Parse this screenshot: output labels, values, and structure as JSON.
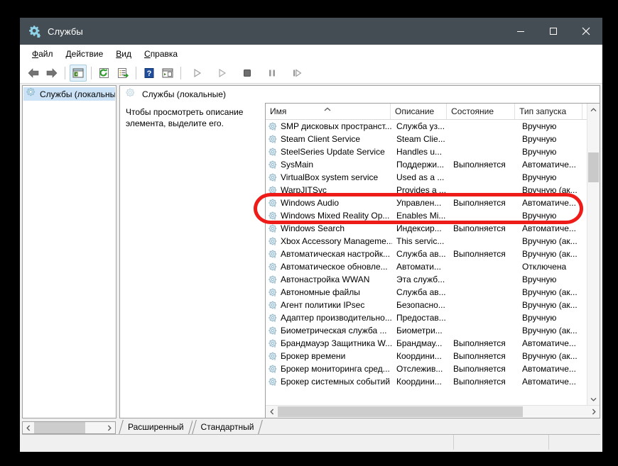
{
  "window": {
    "title": "Службы",
    "title_icon": "services-gear-icon",
    "controls": {
      "minimize": "—",
      "maximize": "□",
      "close": "✕"
    }
  },
  "menubar": {
    "items": [
      {
        "label": "Файл",
        "accel": "Ф"
      },
      {
        "label": "Действие",
        "accel": "Д"
      },
      {
        "label": "Вид",
        "accel": "В"
      },
      {
        "label": "Справка",
        "accel": "С"
      }
    ]
  },
  "toolbar": {
    "buttons": [
      {
        "name": "back-arrow-icon",
        "enabled": true
      },
      {
        "name": "forward-arrow-icon",
        "enabled": true
      },
      {
        "name": "show-hide-console-tree-icon",
        "enabled": true,
        "active": true
      },
      {
        "name": "refresh-icon",
        "enabled": true
      },
      {
        "name": "export-list-icon",
        "enabled": true
      },
      {
        "name": "help-icon",
        "enabled": true
      },
      {
        "name": "show-hide-action-pane-icon",
        "enabled": true
      },
      {
        "name": "start-service-icon",
        "enabled": false
      },
      {
        "name": "restart-service-icon",
        "enabled": false
      },
      {
        "name": "stop-service-icon",
        "enabled": false
      },
      {
        "name": "pause-service-icon",
        "enabled": false
      },
      {
        "name": "resume-service-icon",
        "enabled": false
      }
    ]
  },
  "tree": {
    "items": [
      {
        "label": "Службы (локальны",
        "icon": "services-gear-icon",
        "selected": true
      }
    ]
  },
  "right_pane": {
    "header": "Службы (локальные)",
    "header_icon": "services-gear-icon",
    "description": "Чтобы просмотреть описание элемента, выделите его."
  },
  "list": {
    "columns": [
      {
        "key": "name",
        "label": "Имя",
        "sorted": "asc"
      },
      {
        "key": "description",
        "label": "Описание"
      },
      {
        "key": "state",
        "label": "Состояние"
      },
      {
        "key": "startup",
        "label": "Тип запуска"
      }
    ],
    "rows": [
      {
        "name": "SMP дисковых пространст...",
        "description": "Служба уз...",
        "state": "",
        "startup": "Вручную"
      },
      {
        "name": "Steam Client Service",
        "description": "Steam Clie...",
        "state": "",
        "startup": "Вручную"
      },
      {
        "name": "SteelSeries Update Service",
        "description": "Handles u...",
        "state": "",
        "startup": "Вручную"
      },
      {
        "name": "SysMain",
        "description": "Поддержи...",
        "state": "Выполняется",
        "startup": "Автоматиче..."
      },
      {
        "name": "VirtualBox system service",
        "description": "Used as a ...",
        "state": "",
        "startup": "Вручную"
      },
      {
        "name": "WarpJITSvc",
        "description": "Provides a ...",
        "state": "",
        "startup": "Вручную (ак..."
      },
      {
        "name": "Windows Audio",
        "description": "Управлен...",
        "state": "Выполняется",
        "startup": "Автоматиче...",
        "highlighted": true
      },
      {
        "name": "Windows Mixed Reality Op...",
        "description": "Enables Mi...",
        "state": "",
        "startup": "Вручную"
      },
      {
        "name": "Windows Search",
        "description": "Индексир...",
        "state": "Выполняется",
        "startup": "Автоматиче..."
      },
      {
        "name": "Xbox Accessory Manageme...",
        "description": "This servic...",
        "state": "",
        "startup": "Вручную (ак..."
      },
      {
        "name": "Автоматическая настройк...",
        "description": "Служба ав...",
        "state": "Выполняется",
        "startup": "Вручную (ак..."
      },
      {
        "name": "Автоматическое обновле...",
        "description": "Автомати...",
        "state": "",
        "startup": "Отключена"
      },
      {
        "name": "Автонастройка WWAN",
        "description": "Эта служб...",
        "state": "",
        "startup": "Вручную"
      },
      {
        "name": "Автономные файлы",
        "description": "Служба ав...",
        "state": "",
        "startup": "Вручную (ак..."
      },
      {
        "name": "Агент политики IPsec",
        "description": "Безопасно...",
        "state": "",
        "startup": "Вручную (ак..."
      },
      {
        "name": "Адаптер производительно...",
        "description": "Предостав...",
        "state": "",
        "startup": "Вручную"
      },
      {
        "name": "Биометрическая служба ...",
        "description": "Биометри...",
        "state": "",
        "startup": "Вручную (ак..."
      },
      {
        "name": "Брандмауэр Защитника W...",
        "description": "Брандмау...",
        "state": "Выполняется",
        "startup": "Автоматиче..."
      },
      {
        "name": "Брокер времени",
        "description": "Координи...",
        "state": "Выполняется",
        "startup": "Вручную (ак..."
      },
      {
        "name": "Брокер мониторинга сред...",
        "description": "Отслежив...",
        "state": "Выполняется",
        "startup": "Автоматиче..."
      },
      {
        "name": "Брокер системных событий",
        "description": "Координи...",
        "state": "Выполняется",
        "startup": "Автоматиче..."
      }
    ]
  },
  "tabs": {
    "items": [
      {
        "label": "Расширенный",
        "selected": true
      },
      {
        "label": "Стандартный",
        "selected": false
      }
    ]
  },
  "annotation": {
    "type": "red-oval-highlight",
    "target": "Windows Audio",
    "color": "#ee1c18"
  },
  "colors": {
    "titlebar": "#454d54",
    "window_bg": "#f0f0f0",
    "selection": "#cce3f7",
    "annotation_red": "#ee1c18"
  }
}
